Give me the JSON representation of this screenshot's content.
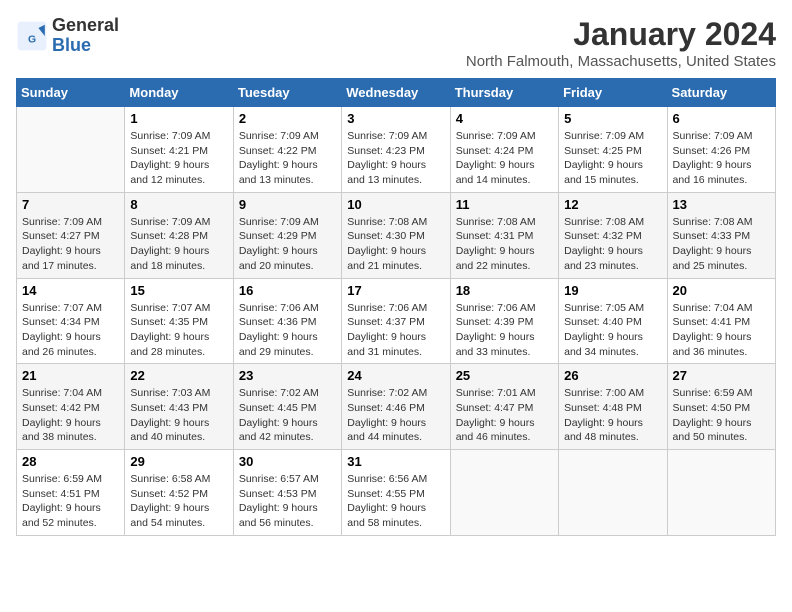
{
  "header": {
    "logo_general": "General",
    "logo_blue": "Blue",
    "title": "January 2024",
    "subtitle": "North Falmouth, Massachusetts, United States"
  },
  "columns": [
    "Sunday",
    "Monday",
    "Tuesday",
    "Wednesday",
    "Thursday",
    "Friday",
    "Saturday"
  ],
  "weeks": [
    [
      {
        "day": "",
        "sunrise": "",
        "sunset": "",
        "daylight": ""
      },
      {
        "day": "1",
        "sunrise": "Sunrise: 7:09 AM",
        "sunset": "Sunset: 4:21 PM",
        "daylight": "Daylight: 9 hours and 12 minutes."
      },
      {
        "day": "2",
        "sunrise": "Sunrise: 7:09 AM",
        "sunset": "Sunset: 4:22 PM",
        "daylight": "Daylight: 9 hours and 13 minutes."
      },
      {
        "day": "3",
        "sunrise": "Sunrise: 7:09 AM",
        "sunset": "Sunset: 4:23 PM",
        "daylight": "Daylight: 9 hours and 13 minutes."
      },
      {
        "day": "4",
        "sunrise": "Sunrise: 7:09 AM",
        "sunset": "Sunset: 4:24 PM",
        "daylight": "Daylight: 9 hours and 14 minutes."
      },
      {
        "day": "5",
        "sunrise": "Sunrise: 7:09 AM",
        "sunset": "Sunset: 4:25 PM",
        "daylight": "Daylight: 9 hours and 15 minutes."
      },
      {
        "day": "6",
        "sunrise": "Sunrise: 7:09 AM",
        "sunset": "Sunset: 4:26 PM",
        "daylight": "Daylight: 9 hours and 16 minutes."
      }
    ],
    [
      {
        "day": "7",
        "sunrise": "Sunrise: 7:09 AM",
        "sunset": "Sunset: 4:27 PM",
        "daylight": "Daylight: 9 hours and 17 minutes."
      },
      {
        "day": "8",
        "sunrise": "Sunrise: 7:09 AM",
        "sunset": "Sunset: 4:28 PM",
        "daylight": "Daylight: 9 hours and 18 minutes."
      },
      {
        "day": "9",
        "sunrise": "Sunrise: 7:09 AM",
        "sunset": "Sunset: 4:29 PM",
        "daylight": "Daylight: 9 hours and 20 minutes."
      },
      {
        "day": "10",
        "sunrise": "Sunrise: 7:08 AM",
        "sunset": "Sunset: 4:30 PM",
        "daylight": "Daylight: 9 hours and 21 minutes."
      },
      {
        "day": "11",
        "sunrise": "Sunrise: 7:08 AM",
        "sunset": "Sunset: 4:31 PM",
        "daylight": "Daylight: 9 hours and 22 minutes."
      },
      {
        "day": "12",
        "sunrise": "Sunrise: 7:08 AM",
        "sunset": "Sunset: 4:32 PM",
        "daylight": "Daylight: 9 hours and 23 minutes."
      },
      {
        "day": "13",
        "sunrise": "Sunrise: 7:08 AM",
        "sunset": "Sunset: 4:33 PM",
        "daylight": "Daylight: 9 hours and 25 minutes."
      }
    ],
    [
      {
        "day": "14",
        "sunrise": "Sunrise: 7:07 AM",
        "sunset": "Sunset: 4:34 PM",
        "daylight": "Daylight: 9 hours and 26 minutes."
      },
      {
        "day": "15",
        "sunrise": "Sunrise: 7:07 AM",
        "sunset": "Sunset: 4:35 PM",
        "daylight": "Daylight: 9 hours and 28 minutes."
      },
      {
        "day": "16",
        "sunrise": "Sunrise: 7:06 AM",
        "sunset": "Sunset: 4:36 PM",
        "daylight": "Daylight: 9 hours and 29 minutes."
      },
      {
        "day": "17",
        "sunrise": "Sunrise: 7:06 AM",
        "sunset": "Sunset: 4:37 PM",
        "daylight": "Daylight: 9 hours and 31 minutes."
      },
      {
        "day": "18",
        "sunrise": "Sunrise: 7:06 AM",
        "sunset": "Sunset: 4:39 PM",
        "daylight": "Daylight: 9 hours and 33 minutes."
      },
      {
        "day": "19",
        "sunrise": "Sunrise: 7:05 AM",
        "sunset": "Sunset: 4:40 PM",
        "daylight": "Daylight: 9 hours and 34 minutes."
      },
      {
        "day": "20",
        "sunrise": "Sunrise: 7:04 AM",
        "sunset": "Sunset: 4:41 PM",
        "daylight": "Daylight: 9 hours and 36 minutes."
      }
    ],
    [
      {
        "day": "21",
        "sunrise": "Sunrise: 7:04 AM",
        "sunset": "Sunset: 4:42 PM",
        "daylight": "Daylight: 9 hours and 38 minutes."
      },
      {
        "day": "22",
        "sunrise": "Sunrise: 7:03 AM",
        "sunset": "Sunset: 4:43 PM",
        "daylight": "Daylight: 9 hours and 40 minutes."
      },
      {
        "day": "23",
        "sunrise": "Sunrise: 7:02 AM",
        "sunset": "Sunset: 4:45 PM",
        "daylight": "Daylight: 9 hours and 42 minutes."
      },
      {
        "day": "24",
        "sunrise": "Sunrise: 7:02 AM",
        "sunset": "Sunset: 4:46 PM",
        "daylight": "Daylight: 9 hours and 44 minutes."
      },
      {
        "day": "25",
        "sunrise": "Sunrise: 7:01 AM",
        "sunset": "Sunset: 4:47 PM",
        "daylight": "Daylight: 9 hours and 46 minutes."
      },
      {
        "day": "26",
        "sunrise": "Sunrise: 7:00 AM",
        "sunset": "Sunset: 4:48 PM",
        "daylight": "Daylight: 9 hours and 48 minutes."
      },
      {
        "day": "27",
        "sunrise": "Sunrise: 6:59 AM",
        "sunset": "Sunset: 4:50 PM",
        "daylight": "Daylight: 9 hours and 50 minutes."
      }
    ],
    [
      {
        "day": "28",
        "sunrise": "Sunrise: 6:59 AM",
        "sunset": "Sunset: 4:51 PM",
        "daylight": "Daylight: 9 hours and 52 minutes."
      },
      {
        "day": "29",
        "sunrise": "Sunrise: 6:58 AM",
        "sunset": "Sunset: 4:52 PM",
        "daylight": "Daylight: 9 hours and 54 minutes."
      },
      {
        "day": "30",
        "sunrise": "Sunrise: 6:57 AM",
        "sunset": "Sunset: 4:53 PM",
        "daylight": "Daylight: 9 hours and 56 minutes."
      },
      {
        "day": "31",
        "sunrise": "Sunrise: 6:56 AM",
        "sunset": "Sunset: 4:55 PM",
        "daylight": "Daylight: 9 hours and 58 minutes."
      },
      {
        "day": "",
        "sunrise": "",
        "sunset": "",
        "daylight": ""
      },
      {
        "day": "",
        "sunrise": "",
        "sunset": "",
        "daylight": ""
      },
      {
        "day": "",
        "sunrise": "",
        "sunset": "",
        "daylight": ""
      }
    ]
  ]
}
